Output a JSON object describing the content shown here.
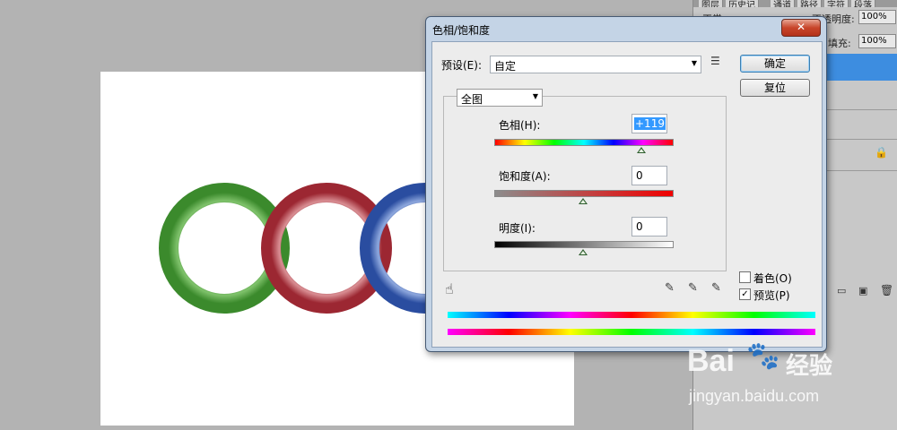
{
  "layers_panel": {
    "tabs": [
      "图层",
      "历史记",
      "通道",
      "路径",
      "字符",
      "段落"
    ],
    "opacity_label": "不透明度:",
    "opacity_value": "100%",
    "fill_label": "填充:",
    "fill_value": "100%",
    "blend_mode": "正常"
  },
  "dialog": {
    "title": "色相/饱和度",
    "close_glyph": "✕",
    "preset_label": "预设(E):",
    "preset_value": "自定",
    "ok_label": "确定",
    "reset_label": "复位",
    "channel_value": "全图",
    "hue_label": "色相(H):",
    "hue_value": "+119",
    "saturation_label": "饱和度(A):",
    "saturation_value": "0",
    "lightness_label": "明度(I):",
    "lightness_value": "0",
    "colorize_label": "着色(O)",
    "colorize_checked": false,
    "preview_label": "预览(P)",
    "preview_checked": true,
    "hue_slider_level": 119,
    "saturation_slider_level": 0,
    "lightness_slider_level": 0
  },
  "icons": {
    "preset_menu": "list-options-icon",
    "hand_tool": "hand-adjust-icon",
    "eyedropper": "eyedropper-icon",
    "eyedropper_add": "eyedropper-plus-icon",
    "eyedropper_subtract": "eyedropper-minus-icon"
  },
  "colors": {
    "dialog_frame": "#c4d4e6",
    "close_button": "#c8452a",
    "selection": "#3399ff",
    "ring_green": "#4d9a3a",
    "ring_red": "#a8303c",
    "ring_blue": "#2d4fa0"
  },
  "watermark": {
    "brand": "Bai",
    "brand_tail": "经验",
    "url": "jingyan.baidu.com"
  }
}
